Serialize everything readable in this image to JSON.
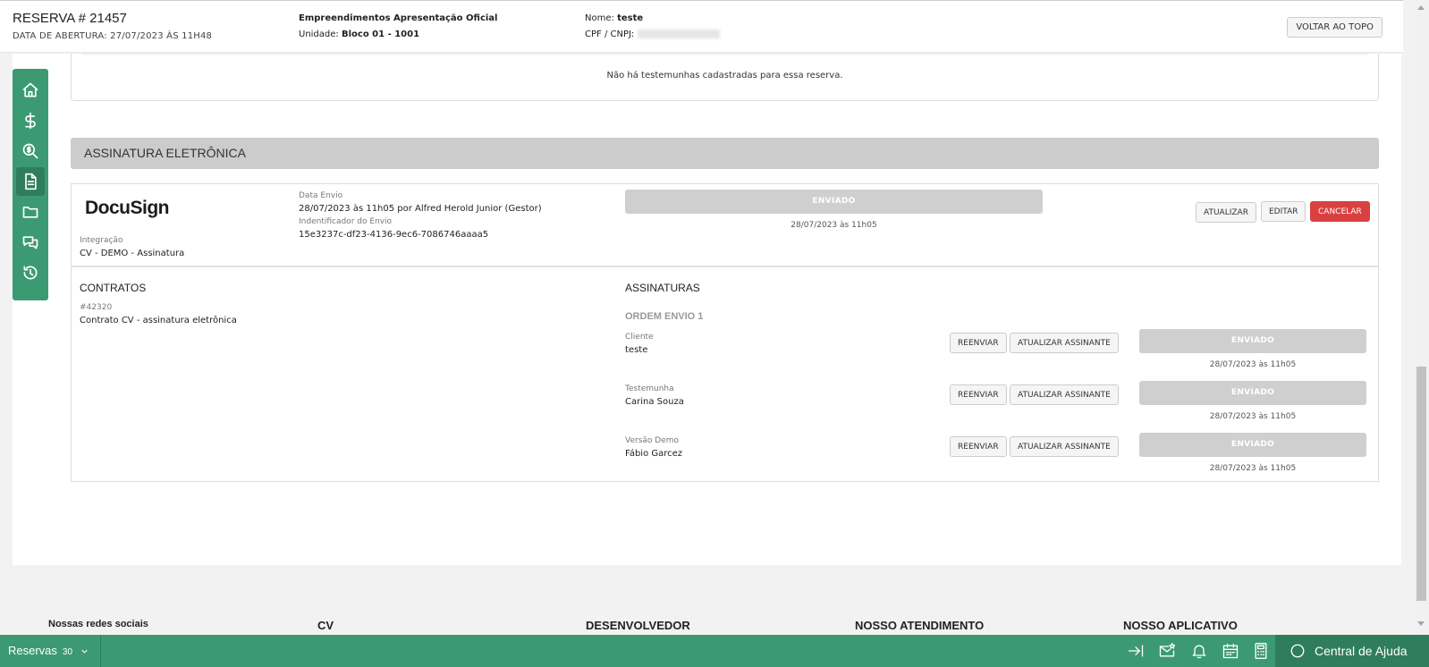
{
  "header": {
    "reserva_title": "RESERVA # 21457",
    "abertura": "DATA DE ABERTURA: 27/07/2023 ÀS 11H48",
    "empreendimento": "Empreendimentos Apresentação Oficial",
    "unidade_label": "Unidade:",
    "unidade_value": "Bloco 01 - 1001",
    "nome_label": "Nome:",
    "nome_value": "teste",
    "cpf_label": "CPF / CNPJ:",
    "voltar_label": "VOLTAR AO TOPO"
  },
  "sidenav": {
    "items": [
      "home-icon",
      "dollar-icon",
      "search-dollar-icon",
      "document-icon",
      "folder-icon",
      "comments-icon",
      "history-icon"
    ]
  },
  "testemunhas": {
    "empty_message": "Não há testemunhas cadastradas para essa reserva."
  },
  "assinatura": {
    "section_title": "ASSINATURA ELETRÔNICA",
    "provider": "DocuSign",
    "integracao_label": "Integração",
    "integracao_value": "CV - DEMO - Assinatura",
    "data_envio_label": "Data Envio",
    "data_envio_value": "28/07/2023 às 11h05 por Alfred Herold Junior (Gestor)",
    "identificador_label": "Indentificador do Envio",
    "identificador_value": "15e3237c-df23-4136-9ec6-7086746aaaa5",
    "status": "ENVIADO",
    "status_date": "28/07/2023 às 11h05",
    "btn_atualizar": "ATUALIZAR",
    "btn_editar": "EDITAR",
    "btn_cancelar": "CANCELAR",
    "colors": {
      "cancel": "#d94040",
      "brand": "#3c9a72"
    }
  },
  "contratos": {
    "title": "CONTRATOS",
    "id": "#42320",
    "name": "Contrato CV - assinatura eletrônica"
  },
  "assinaturas": {
    "title": "ASSINATURAS",
    "ordem": "ORDEM ENVIO 1",
    "btn_reenviar": "REENVIAR",
    "btn_atualizar_assinante": "ATUALIZAR ASSINANTE",
    "signers": [
      {
        "role": "Cliente",
        "name": "teste",
        "status": "ENVIADO",
        "date": "28/07/2023 às 11h05"
      },
      {
        "role": "Testemunha",
        "name": "Carina Souza",
        "status": "ENVIADO",
        "date": "28/07/2023 às 11h05"
      },
      {
        "role": "Versão Demo",
        "name": "Fábio Garcez",
        "status": "ENVIADO",
        "date": "28/07/2023 às 11h05"
      }
    ]
  },
  "footer": {
    "social": "Nossas redes sociais",
    "cv": "CV",
    "dev": "DESENVOLVEDOR",
    "atendimento": "NOSSO ATENDIMENTO",
    "app": "NOSSO APLICATIVO"
  },
  "bottombar": {
    "reservas_label": "Reservas",
    "reservas_count": "30",
    "help_label": "Central de Ajuda"
  }
}
